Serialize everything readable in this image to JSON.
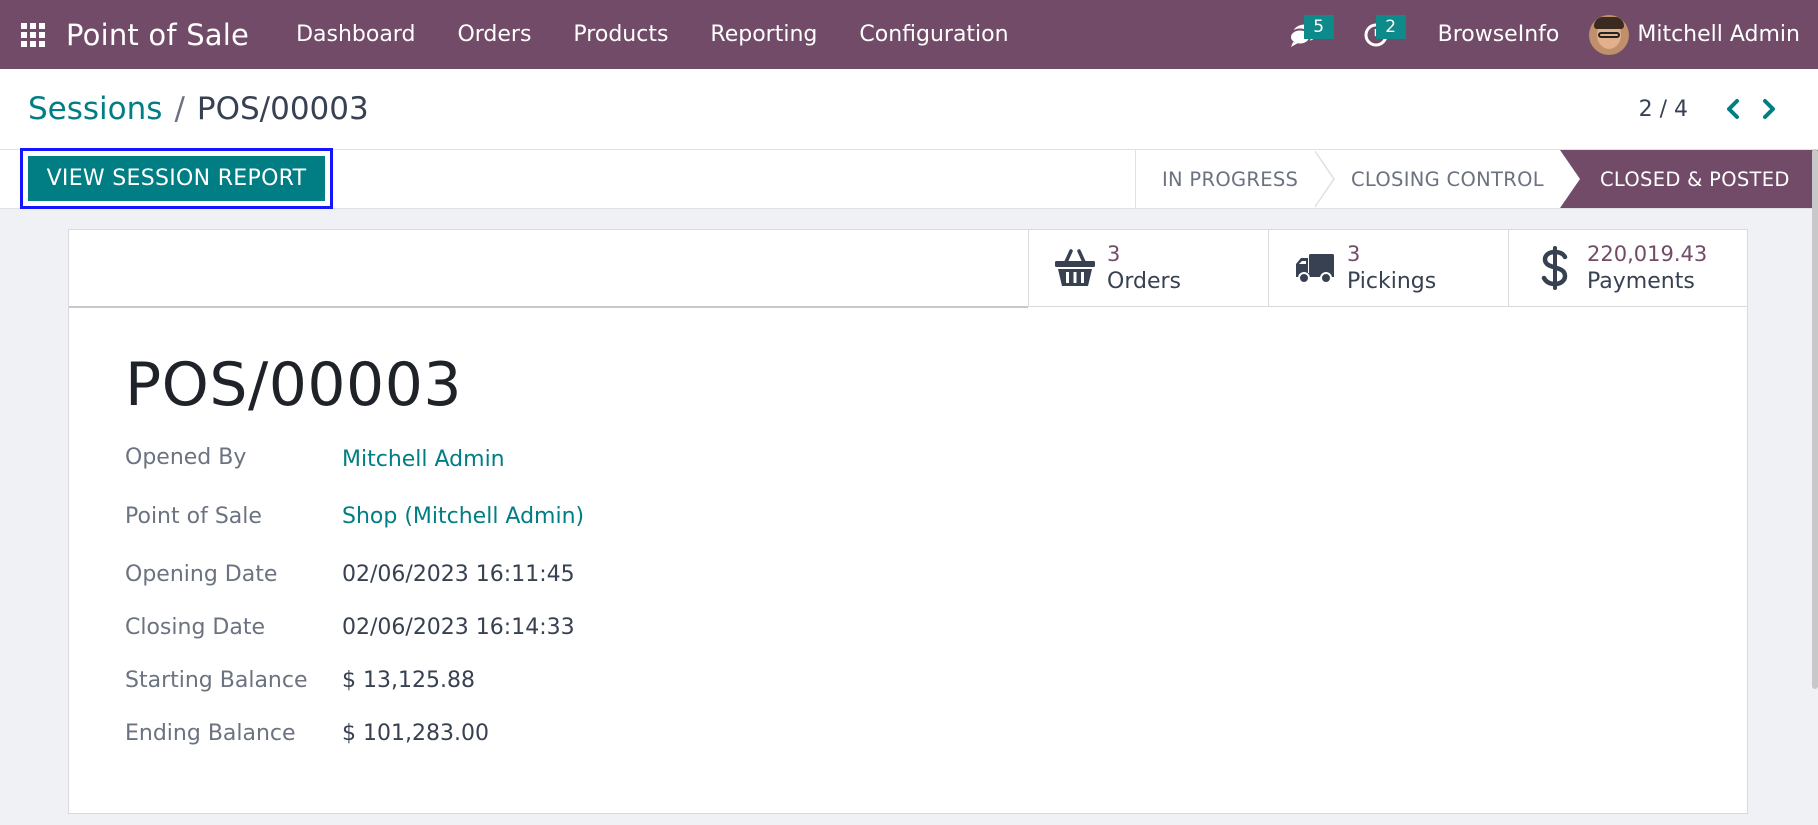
{
  "navbar": {
    "app_name": "Point of Sale",
    "menu": [
      "Dashboard",
      "Orders",
      "Products",
      "Reporting",
      "Configuration"
    ],
    "messages_count": "5",
    "activities_count": "2",
    "company": "BrowseInfo",
    "user": "Mitchell Admin"
  },
  "breadcrumb": {
    "parent": "Sessions",
    "separator": "/",
    "current": "POS/00003"
  },
  "pager": {
    "text": "2 / 4"
  },
  "controls": {
    "session_report_label": "VIEW SESSION REPORT"
  },
  "statusbar": {
    "stages": [
      "IN PROGRESS",
      "CLOSING CONTROL",
      "CLOSED & POSTED"
    ],
    "active": "CLOSED & POSTED"
  },
  "smart_buttons": {
    "orders": {
      "value": "3",
      "label": "Orders",
      "icon": "basket-icon"
    },
    "pickings": {
      "value": "3",
      "label": "Pickings",
      "icon": "truck-icon"
    },
    "payments": {
      "value": "220,019.43",
      "label": "Payments",
      "icon": "dollar-icon"
    }
  },
  "record": {
    "title": "POS/00003",
    "fields": [
      {
        "label": "Opened By",
        "value": "Mitchell Admin"
      },
      {
        "label": "Point of Sale",
        "value": "Shop (Mitchell Admin)"
      },
      {
        "label": "Opening Date",
        "value": "02/06/2023 16:11:45"
      },
      {
        "label": "Closing Date",
        "value": "02/06/2023 16:14:33"
      },
      {
        "label": "Starting Balance",
        "value": "$ 13,125.88"
      },
      {
        "label": "Ending Balance",
        "value": "$ 101,283.00"
      }
    ]
  },
  "colors": {
    "navbar": "#714b67",
    "primary": "#017e84",
    "badge": "#0e8a8a",
    "highlight_border": "#1515ff"
  }
}
